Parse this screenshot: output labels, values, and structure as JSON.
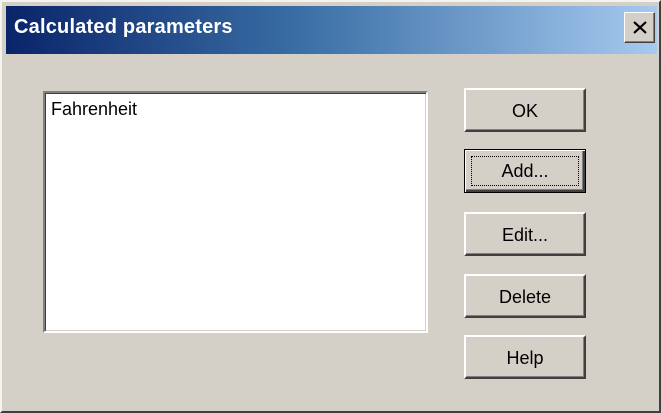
{
  "window": {
    "title": "Calculated parameters",
    "close_glyph": "close-icon"
  },
  "listbox": {
    "items": [
      "Fahrenheit"
    ]
  },
  "buttons": {
    "ok": "OK",
    "add": "Add...",
    "edit": "Edit...",
    "delete": "Delete",
    "help": "Help"
  },
  "colors": {
    "face": "#d4d0c8",
    "title_start": "#0a246a",
    "title_end": "#a6caf0"
  }
}
